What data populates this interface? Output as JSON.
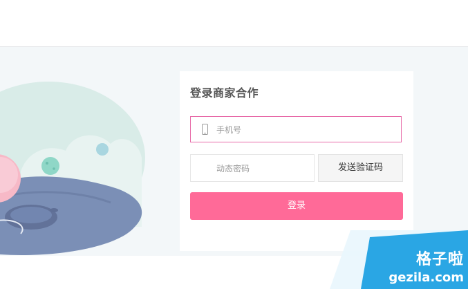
{
  "login": {
    "title": "登录商家合作",
    "phone_placeholder": "手机号",
    "code_placeholder": "动态密码",
    "send_code_label": "发送验证码",
    "login_label": "登录"
  },
  "watermark": {
    "name": "格子啦",
    "domain": "gezila.com"
  },
  "colors": {
    "accent": "#ff6a98",
    "focus_border": "#e76aa8",
    "stage_background": "#f3f7f9",
    "watermark": "#2aa6e4"
  },
  "icons": {
    "phone_field": "phone-icon"
  }
}
